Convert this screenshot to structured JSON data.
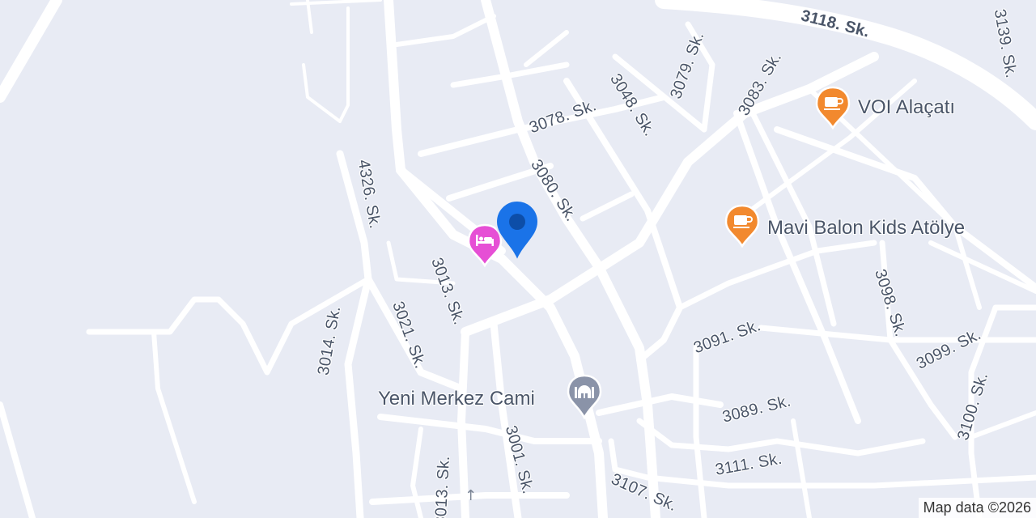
{
  "map": {
    "attribution": "Map data ©2026",
    "colors": {
      "background": "#e8ebf4",
      "road": "#ffffff",
      "cafe": "#f2892e",
      "hotel": "#e64fd5",
      "landmark": "#8a93a8",
      "location": "#1a73e8"
    },
    "streets": [
      "3118. Sk.",
      "3139. Sk.",
      "3079. Sk.",
      "3083. Sk.",
      "3078. Sk.",
      "3048. Sk.",
      "3080. Sk.",
      "4326. Sk.",
      "3013. Sk.",
      "3021. Sk.",
      "3014. Sk.",
      "3091. Sk.",
      "3098. Sk.",
      "3099. Sk.",
      "3100. Sk.",
      "3089. Sk.",
      "3001. Sk.",
      "3111. Sk.",
      "3107. Sk.",
      "3013. Sk."
    ],
    "pois": [
      {
        "name": "VOI Alaçatı",
        "icon": "cafe-icon"
      },
      {
        "name": "Mavi Balon Kids Atölye",
        "icon": "cafe-icon"
      },
      {
        "name": "Yeni Merkez Cami",
        "icon": "mosque-icon"
      },
      {
        "name": "",
        "icon": "hotel-icon"
      }
    ],
    "current_location": {
      "icon": "location-pin-icon"
    }
  }
}
